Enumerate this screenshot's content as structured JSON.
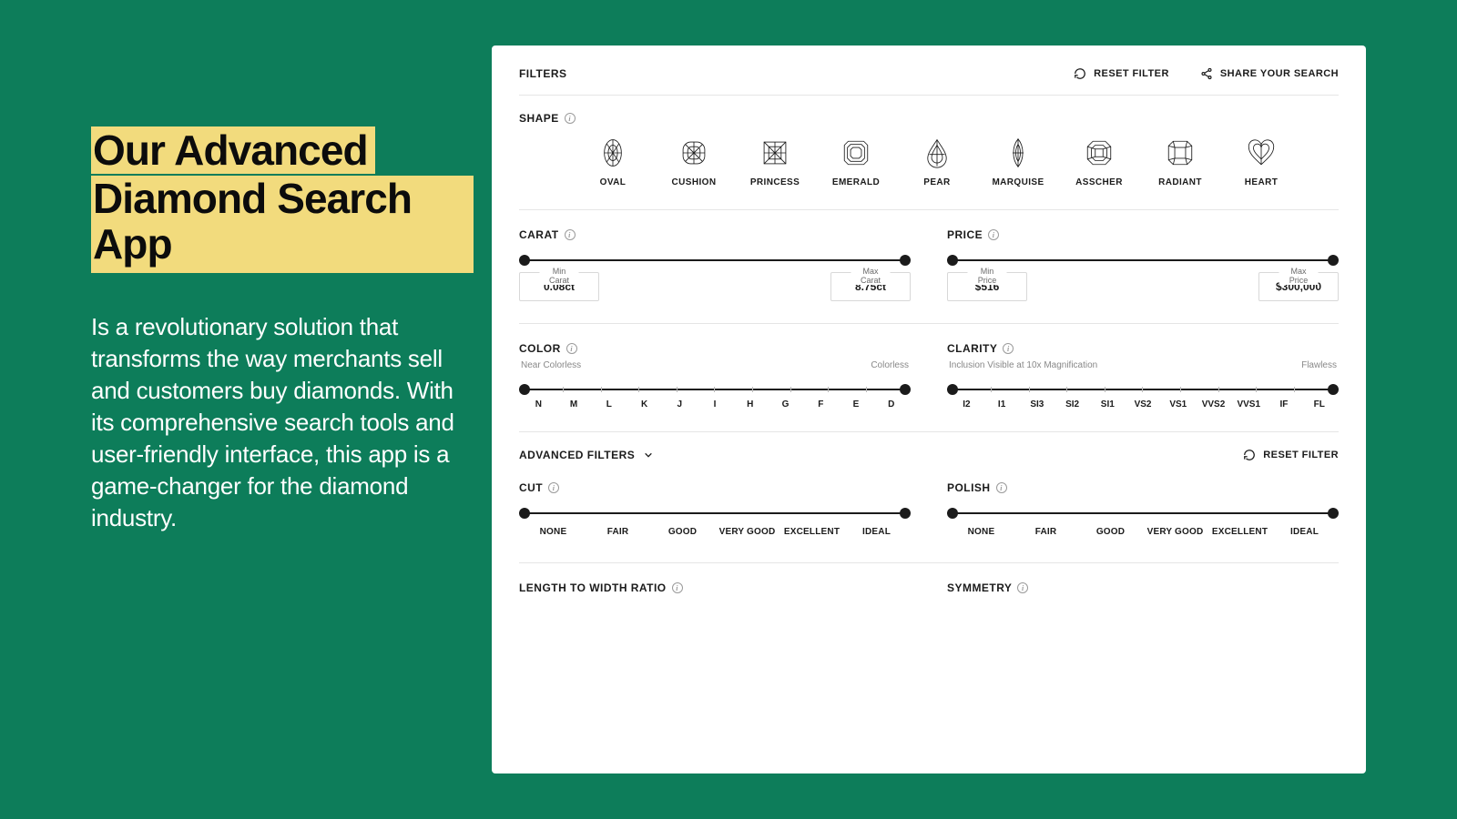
{
  "hero": {
    "headline1": "Our Advanced",
    "headline2": "Diamond Search App",
    "body": "Is a revolutionary solution that transforms the way merchants sell and customers buy diamonds. With its comprehensive search tools and user-friendly interface, this app is a game-changer for the diamond industry."
  },
  "header": {
    "filters_label": "FILTERS",
    "reset_label": "RESET FILTER",
    "share_label": "SHARE YOUR SEARCH"
  },
  "shape": {
    "label": "SHAPE",
    "options": [
      "OVAL",
      "CUSHION",
      "PRINCESS",
      "EMERALD",
      "PEAR",
      "MARQUISE",
      "ASSCHER",
      "RADIANT",
      "HEART"
    ]
  },
  "carat": {
    "label": "CARAT",
    "min_label": "Min Carat",
    "min_value": "0.08ct",
    "max_label": "Max Carat",
    "max_value": "8.75ct"
  },
  "price": {
    "label": "PRICE",
    "min_label": "Min Price",
    "min_value": "$516",
    "max_label": "Max Price",
    "max_value": "$300,000"
  },
  "color": {
    "label": "COLOR",
    "low_hint": "Near Colorless",
    "high_hint": "Colorless",
    "ticks": [
      "N",
      "M",
      "L",
      "K",
      "J",
      "I",
      "H",
      "G",
      "F",
      "E",
      "D"
    ]
  },
  "clarity": {
    "label": "CLARITY",
    "low_hint": "Inclusion Visible at 10x Magnification",
    "high_hint": "Flawless",
    "ticks": [
      "I2",
      "I1",
      "SI3",
      "SI2",
      "SI1",
      "VS2",
      "VS1",
      "VVS2",
      "VVS1",
      "IF",
      "FL"
    ]
  },
  "advanced": {
    "label": "ADVANCED FILTERS",
    "reset_label": "RESET FILTER"
  },
  "cut": {
    "label": "CUT",
    "ticks": [
      "NONE",
      "FAIR",
      "GOOD",
      "VERY GOOD",
      "EXCELLENT",
      "IDEAL"
    ]
  },
  "polish": {
    "label": "POLISH",
    "ticks": [
      "NONE",
      "FAIR",
      "GOOD",
      "VERY GOOD",
      "EXCELLENT",
      "IDEAL"
    ]
  },
  "lwr": {
    "label": "LENGTH TO WIDTH RATIO"
  },
  "symmetry": {
    "label": "SYMMETRY"
  }
}
